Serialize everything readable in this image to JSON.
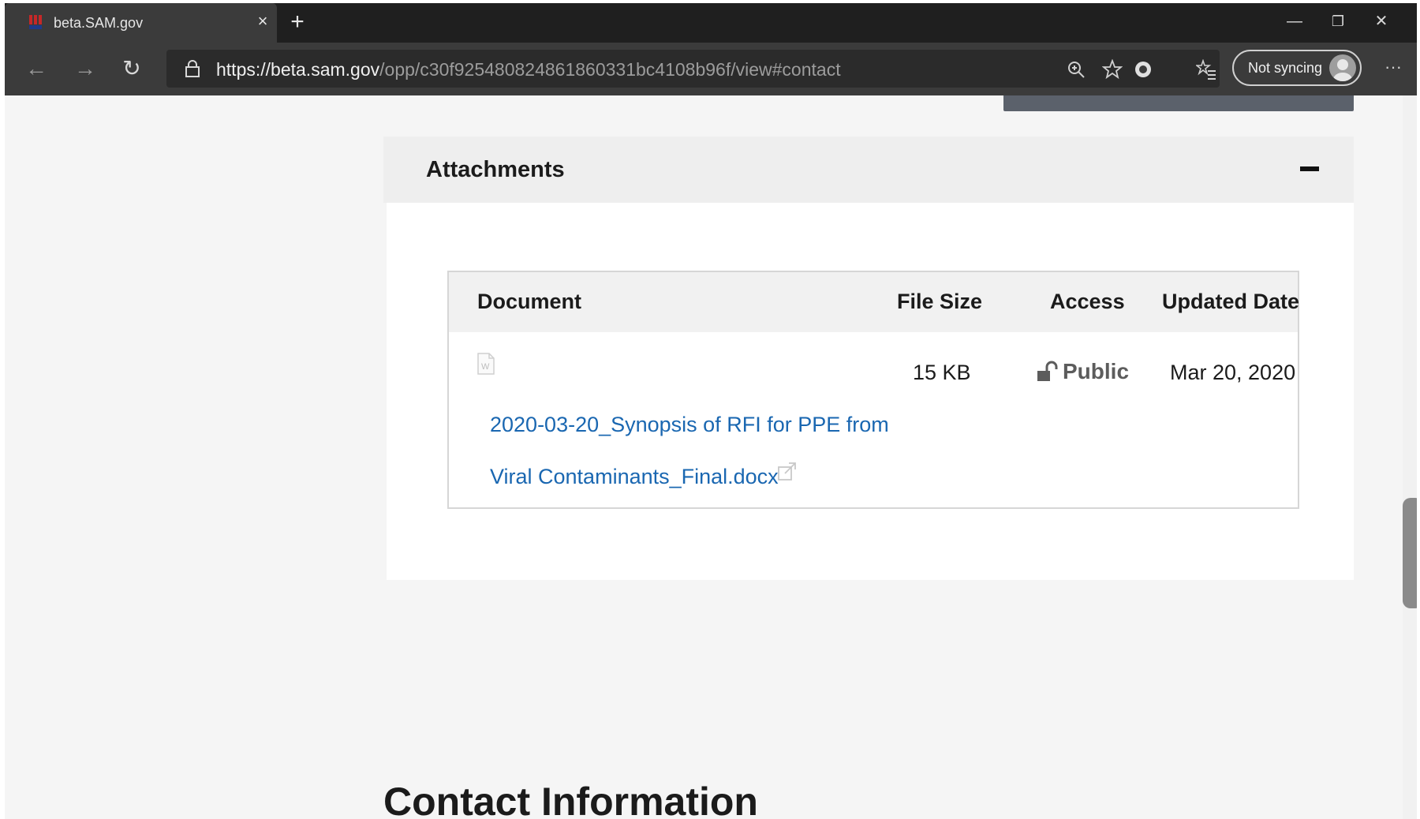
{
  "browser": {
    "tab_title": "beta.SAM.gov",
    "tab_close": "×",
    "new_tab": "+",
    "url": {
      "scheme": "https://",
      "host": "beta.sam.gov",
      "path": "/opp/c30f925480824861860331bc4108b96f/view#contact"
    },
    "sync_label": "Not syncing",
    "more": "···",
    "window_controls": {
      "minimize": "—",
      "restore": "❐",
      "close": "✕"
    },
    "nav": {
      "back": "←",
      "forward": "→",
      "refresh": "↻"
    },
    "icons": [
      "zoom-icon",
      "favorite-star-icon",
      "extension-icon",
      "favorites-list-icon"
    ]
  },
  "attachments": {
    "title": "Attachments",
    "table": {
      "columns": [
        "Document",
        "File Size",
        "Access",
        "Updated Date"
      ],
      "rows": [
        {
          "document_line1": "2020-03-20_Synopsis of RFI for PPE from",
          "document_line2": "Viral Contaminants_Final.docx",
          "file_size": "15 KB",
          "access": "Public",
          "updated_date": "Mar 20, 2020"
        }
      ]
    }
  },
  "contact": {
    "heading": "Contact Information"
  },
  "colors": {
    "link": "#1a67b1",
    "tab_bar": "#1f1f1f",
    "toolbar": "#3b3b3b",
    "button_gray": "#5b616b"
  }
}
